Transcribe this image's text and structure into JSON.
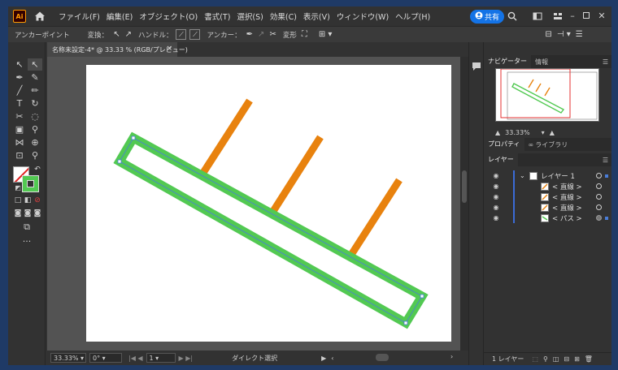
{
  "app": {
    "logo_text": "Ai",
    "menus": [
      "ファイル(F)",
      "編集(E)",
      "オブジェクト(O)",
      "書式(T)",
      "選択(S)",
      "効果(C)",
      "表示(V)",
      "ウィンドウ(W)",
      "ヘルプ(H)"
    ],
    "share_label": "共有"
  },
  "control_bar": {
    "anchor_point_label": "アンカーポイント",
    "convert_label": "変換：",
    "handle_label": "ハンドル：",
    "anchor_label": "アンカー：",
    "transform_label": "変形"
  },
  "document": {
    "tab_title": "名称未設定-4* @ 33.33 % (RGB/プレビュー)",
    "close_glyph": "×"
  },
  "status_bar": {
    "zoom": "33.33%",
    "rotation": "0°",
    "artboard_number": "1",
    "tool_name": "ダイレクト選択"
  },
  "navigator": {
    "tab_navigator": "ナビゲーター",
    "tab_info": "情報",
    "zoom": "33.33%"
  },
  "properties_tabs": {
    "properties": "プロパティ",
    "libraries": "ライブラリ"
  },
  "layers": {
    "tab_label": "レイヤー",
    "rows": [
      {
        "name": "レイヤー 1",
        "type": "layer"
      },
      {
        "name": "< 直線 >",
        "type": "line"
      },
      {
        "name": "< 直線 >",
        "type": "line"
      },
      {
        "name": "< 直線 >",
        "type": "line"
      },
      {
        "name": "< パス >",
        "type": "path"
      }
    ],
    "count_label": "1 レイヤー"
  },
  "colors": {
    "accent": "#1473e6",
    "green_stroke": "#52c952",
    "orange_line": "#e8820e",
    "selection": "#4a7dd8"
  }
}
